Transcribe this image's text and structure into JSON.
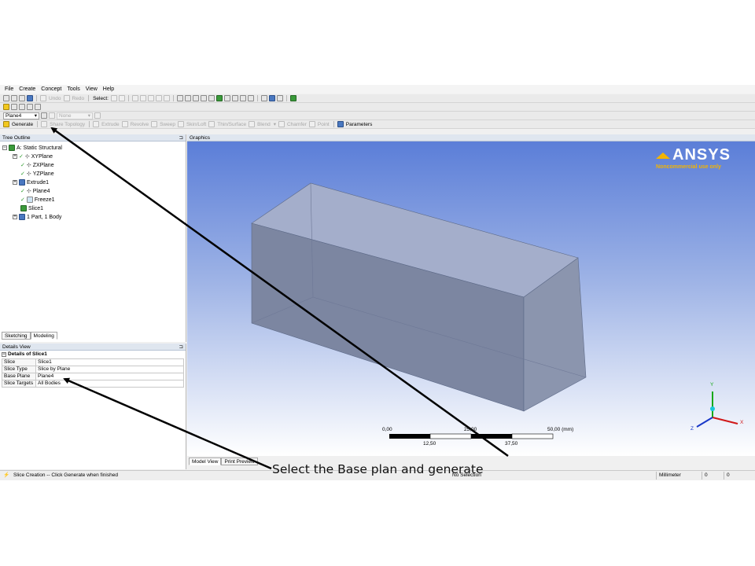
{
  "menu": [
    "File",
    "Create",
    "Concept",
    "Tools",
    "View",
    "Help"
  ],
  "toolbar1": {
    "undo_label": "Undo",
    "redo_label": "Redo",
    "select_label": "Select:"
  },
  "toolbar3": {
    "plane_value": "Plane4",
    "sketch_value": "None"
  },
  "toolbar4": {
    "generate_label": "Generate",
    "share_topology_label": "Share Topology",
    "extrude_label": "Extrude",
    "revolve_label": "Revolve",
    "sweep_label": "Sweep",
    "skinloft_label": "Skin/Loft",
    "thinsurface_label": "Thin/Surface",
    "blend_label": "Blend",
    "chamfer_label": "Chamfer",
    "point_label": "Point",
    "parameters_label": "Parameters"
  },
  "tree": {
    "title": "Tree Outline",
    "root_label": "A: Static Structural",
    "items": [
      {
        "label": "XYPlane"
      },
      {
        "label": "ZXPlane"
      },
      {
        "label": "YZPlane"
      },
      {
        "label": "Extrude1"
      },
      {
        "label": "Plane4"
      },
      {
        "label": "Freeze1"
      },
      {
        "label": "Slice1"
      },
      {
        "label": "1 Part, 1 Body"
      }
    ],
    "tabs": [
      "Sketching",
      "Modeling"
    ]
  },
  "details": {
    "title": "Details View",
    "group_label": "Details of Slice1",
    "rows": [
      {
        "key": "Slice",
        "value": "Slice1"
      },
      {
        "key": "Slice Type",
        "value": "Slice by Plane"
      },
      {
        "key": "Base Plane",
        "value": "Plane4"
      },
      {
        "key": "Slice Targets",
        "value": "All Bodies"
      }
    ]
  },
  "graphics": {
    "title": "Graphics",
    "logo_text": "ANSYS",
    "logo_sub": "Noncommercial use only",
    "scale_top": [
      "0,00",
      "25,00",
      "50,00 (mm)"
    ],
    "scale_bottom": [
      "12,50",
      "37,50"
    ],
    "triad": {
      "x": "X",
      "y": "Y",
      "z": "Z"
    },
    "tabs": [
      "Model View",
      "Print Preview"
    ]
  },
  "status": {
    "message": "Slice Creation -- Click Generate when finished",
    "selection": "No Selection",
    "units": "Millimeter",
    "v1": "0",
    "v2": "0"
  },
  "caption": "Select the Base plan and generate",
  "colors": {
    "viewport_top": "#5b7ed8",
    "viewport_bottom": "#ffffff",
    "logo_yellow": "#f3b400",
    "annotation_arrow": "#000000"
  }
}
